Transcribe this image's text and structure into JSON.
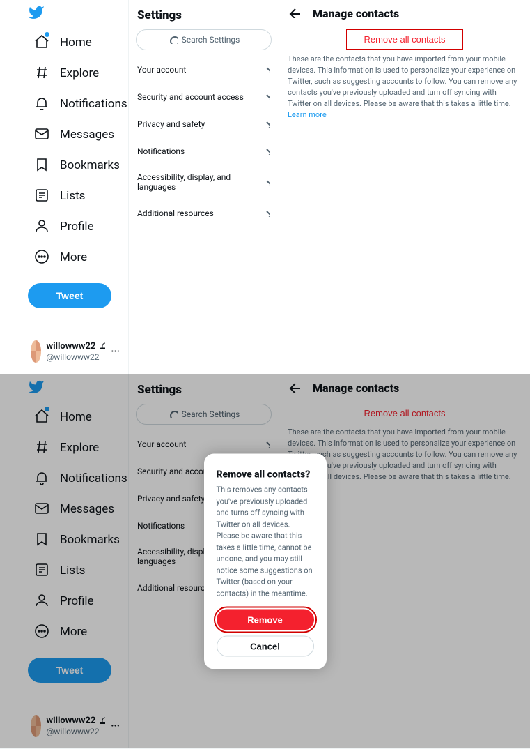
{
  "nav": {
    "items": [
      {
        "key": "home",
        "label": "Home",
        "dot": true
      },
      {
        "key": "explore",
        "label": "Explore"
      },
      {
        "key": "notifications",
        "label": "Notifications"
      },
      {
        "key": "messages",
        "label": "Messages"
      },
      {
        "key": "bookmarks",
        "label": "Bookmarks"
      },
      {
        "key": "lists",
        "label": "Lists"
      },
      {
        "key": "profile",
        "label": "Profile"
      },
      {
        "key": "more",
        "label": "More"
      }
    ],
    "tweet_label": "Tweet"
  },
  "account": {
    "display_name": "willowww22",
    "handle": "@willowww22",
    "locked": true
  },
  "settings": {
    "title": "Settings",
    "search_placeholder": "Search Settings",
    "items": [
      {
        "label": "Your account"
      },
      {
        "label": "Security and account access"
      },
      {
        "label": "Privacy and safety"
      },
      {
        "label": "Notifications"
      },
      {
        "label": "Accessibility, display, and languages"
      },
      {
        "label": "Additional resources"
      }
    ]
  },
  "detail": {
    "title": "Manage contacts",
    "remove_all_label": "Remove all contacts",
    "description": "These are the contacts that you have imported from your mobile devices. This information is used to personalize your experience on Twitter, such as suggesting accounts to follow. You can remove any contacts you've previously uploaded and turn off syncing with Twitter on all devices. Please be aware that this takes a little time.",
    "learn_more": "Learn more"
  },
  "modal": {
    "title": "Remove all contacts?",
    "body": "This removes any contacts you've previously uploaded and turns off syncing with Twitter on all devices. Please be aware that this takes a little time, cannot be undone, and you may still notice some suggestions on Twitter (based on your contacts) in the meantime.",
    "remove_label": "Remove",
    "cancel_label": "Cancel"
  },
  "colors": {
    "accent": "#1d9bf0",
    "danger": "#f4212e"
  },
  "icons": {
    "home": "home-icon",
    "explore": "hash-icon",
    "notifications": "bell-icon",
    "messages": "envelope-icon",
    "bookmarks": "bookmark-icon",
    "lists": "list-icon",
    "profile": "person-icon",
    "more": "more-circle-icon"
  }
}
